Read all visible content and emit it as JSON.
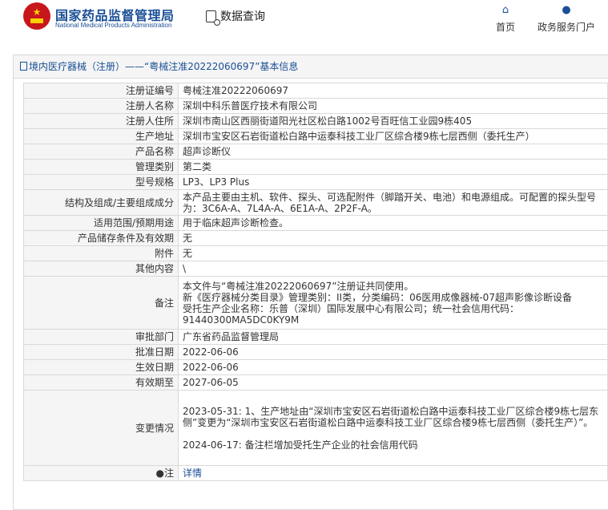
{
  "header": {
    "brand_cn": "国家药品监督管理局",
    "brand_en": "National Medical Products Administration",
    "query_label": "数据查询",
    "nav_home": "首页",
    "nav_portal": "政务服务门户"
  },
  "section": {
    "breadcrumb": "境内医疗器械（注册）——“粤械注准20222060697”基本信息"
  },
  "rows": [
    {
      "label": "注册证编号",
      "value": "粤械注准20222060697"
    },
    {
      "label": "注册人名称",
      "value": "深圳中科乐普医疗技术有限公司"
    },
    {
      "label": "注册人住所",
      "value": "深圳市南山区西丽街道阳光社区松白路1002号百旺信工业园9栋405"
    },
    {
      "label": "生产地址",
      "value": "深圳市宝安区石岩街道松白路中运泰科技工业厂区综合楼9栋七层西侧（委托生产）"
    },
    {
      "label": "产品名称",
      "value": "超声诊断仪"
    },
    {
      "label": "管理类别",
      "value": "第二类"
    },
    {
      "label": "型号规格",
      "value": "LP3、LP3 Plus"
    },
    {
      "label": "结构及组成/主要组成成分",
      "value": "本产品主要由主机、软件、探头、可选配附件（脚踏开关、电池）和电源组成。可配置的探头型号为：3C6A-A、7L4A-A、6E1A-A、2P2F-A。"
    },
    {
      "label": "适用范围/预期用途",
      "value": "用于临床超声诊断检查。"
    },
    {
      "label": "产品储存条件及有效期",
      "value": "无"
    },
    {
      "label": "附件",
      "value": "无"
    },
    {
      "label": "其他内容",
      "value": "\\"
    },
    {
      "label": "备注",
      "value": "本文件与“粤械注准20222060697”注册证共同使用。\n新《医疗器械分类目录》管理类别：II类，分类编码：06医用成像器械-07超声影像诊断设备\n受托生产企业名称：乐普（深圳）国际发展中心有限公司；统一社会信用代码：91440300MA5DC0KY9M"
    },
    {
      "label": "审批部门",
      "value": "广东省药品监督管理局"
    },
    {
      "label": "批准日期",
      "value": "2022-06-06"
    },
    {
      "label": "生效日期",
      "value": "2022-06-06"
    },
    {
      "label": "有效期至",
      "value": "2027-06-05"
    }
  ],
  "change": {
    "label": "变更情况",
    "entry1": "2023-05-31: 1、生产地址由“深圳市宝安区石岩街道松白路中运泰科技工业厂区综合楼9栋七层东侧”变更为“深圳市宝安区石岩街道松白路中运泰科技工业厂区综合楼9栋七层西侧（委托生产）”。",
    "entry2": "2024-06-17: 备注栏增加受托生产企业的社会信用代码"
  },
  "note": {
    "label": "注",
    "link": "详情"
  }
}
